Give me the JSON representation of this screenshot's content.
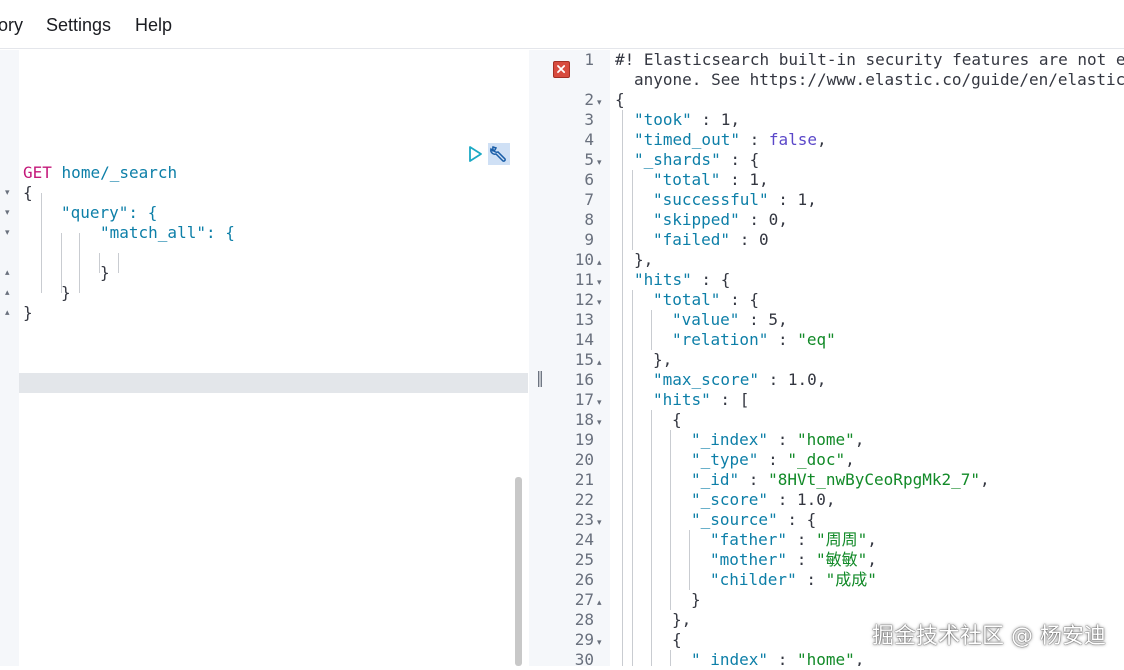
{
  "menu": {
    "history_label": "ory",
    "settings_label": "Settings",
    "help_label": "Help"
  },
  "request": {
    "method": "GET",
    "path": "home/_search",
    "lines": [
      "{",
      "\"query\": {",
      "\"match_all\": {",
      "",
      "}",
      "}",
      "}"
    ]
  },
  "response": {
    "line_numbers": [
      "1",
      "2",
      "3",
      "4",
      "5",
      "6",
      "7",
      "8",
      "9",
      "10",
      "11",
      "12",
      "13",
      "14",
      "15",
      "16",
      "17",
      "18",
      "19",
      "20",
      "21",
      "22",
      "23",
      "24",
      "25",
      "26",
      "27",
      "28",
      "29",
      "30"
    ],
    "warning_line1": "#! Elasticsearch built-in security features are not e",
    "warning_line2": "anyone. See https://www.elastic.co/guide/en/elastic",
    "took": "1",
    "timed_out": "false",
    "shards_total": "1",
    "shards_successful": "1",
    "shards_skipped": "0",
    "shards_failed": "0",
    "hits_total_value": "5",
    "hits_total_relation": "\"eq\"",
    "max_score": "1.0",
    "hit_index": "\"home\"",
    "hit_type": "\"_doc\"",
    "hit_id": "\"8HVt_nwByCeoRpgMk2_7\"",
    "hit_score": "1.0",
    "source_father": "\"周周\"",
    "source_mother": "\"敏敏\"",
    "source_childer": "\"成成\"",
    "hit2_index": "\"home\""
  },
  "watermark": "掘金技术社区 @ 杨安迪",
  "colors": {
    "key": "#0d7fa8",
    "string": "#128a28",
    "boolean": "#5b48c9",
    "method": "#c4187a",
    "error": "#d84b3e"
  },
  "icons": [
    "run-icon",
    "wrench-icon",
    "error-icon",
    "fold-arrow-icon"
  ]
}
